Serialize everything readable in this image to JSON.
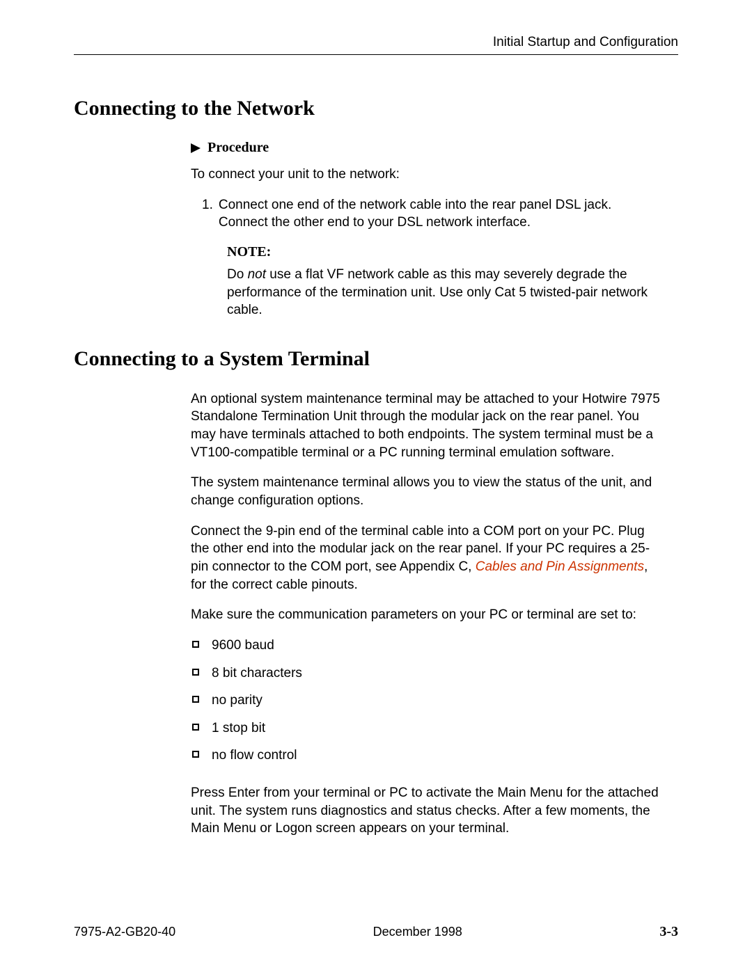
{
  "header": {
    "right_text": "Initial Startup and Configuration"
  },
  "section1": {
    "title": "Connecting to the Network",
    "procedure_label": "Procedure",
    "intro": "To connect your unit to the network:",
    "step1_num": "1.",
    "step1_text": "Connect one end of the network cable into the rear panel DSL jack. Connect the other end to your DSL network interface.",
    "note_title": "NOTE:",
    "note_pre": "Do ",
    "note_not": "not",
    "note_post": " use a flat VF network cable as this may severely degrade the performance of the termination unit. Use only Cat 5 twisted-pair network cable."
  },
  "section2": {
    "title": "Connecting to a System Terminal",
    "para1": "An optional system maintenance terminal may be attached to your Hotwire 7975 Standalone Termination Unit through the modular jack on the rear panel. You may have terminals attached to both endpoints. The system terminal must be a VT100-compatible terminal or a PC running terminal emulation software.",
    "para2": "The system maintenance terminal allows you to view the status of the unit, and change configuration options.",
    "para3_pre": "Connect the 9-pin end of the terminal cable into a COM port on your PC. Plug the other end into the modular jack on the rear panel. If your PC requires a 25-pin connector to the COM port, see Appendix C, ",
    "para3_link": "Cables and Pin Assignments",
    "para3_post": ", for the correct cable pinouts.",
    "para4": "Make sure the communication parameters on your PC or terminal are set to:",
    "bullets": {
      "b1": "9600 baud",
      "b2": "8 bit characters",
      "b3": "no parity",
      "b4": "1 stop bit",
      "b5": "no flow control"
    },
    "para5": "Press Enter from your terminal or PC to activate the Main Menu for the attached unit. The system runs diagnostics and status checks. After a few moments, the Main Menu or Logon screen appears on your terminal."
  },
  "footer": {
    "left": "7975-A2-GB20-40",
    "center": "December 1998",
    "right": "3-3"
  }
}
